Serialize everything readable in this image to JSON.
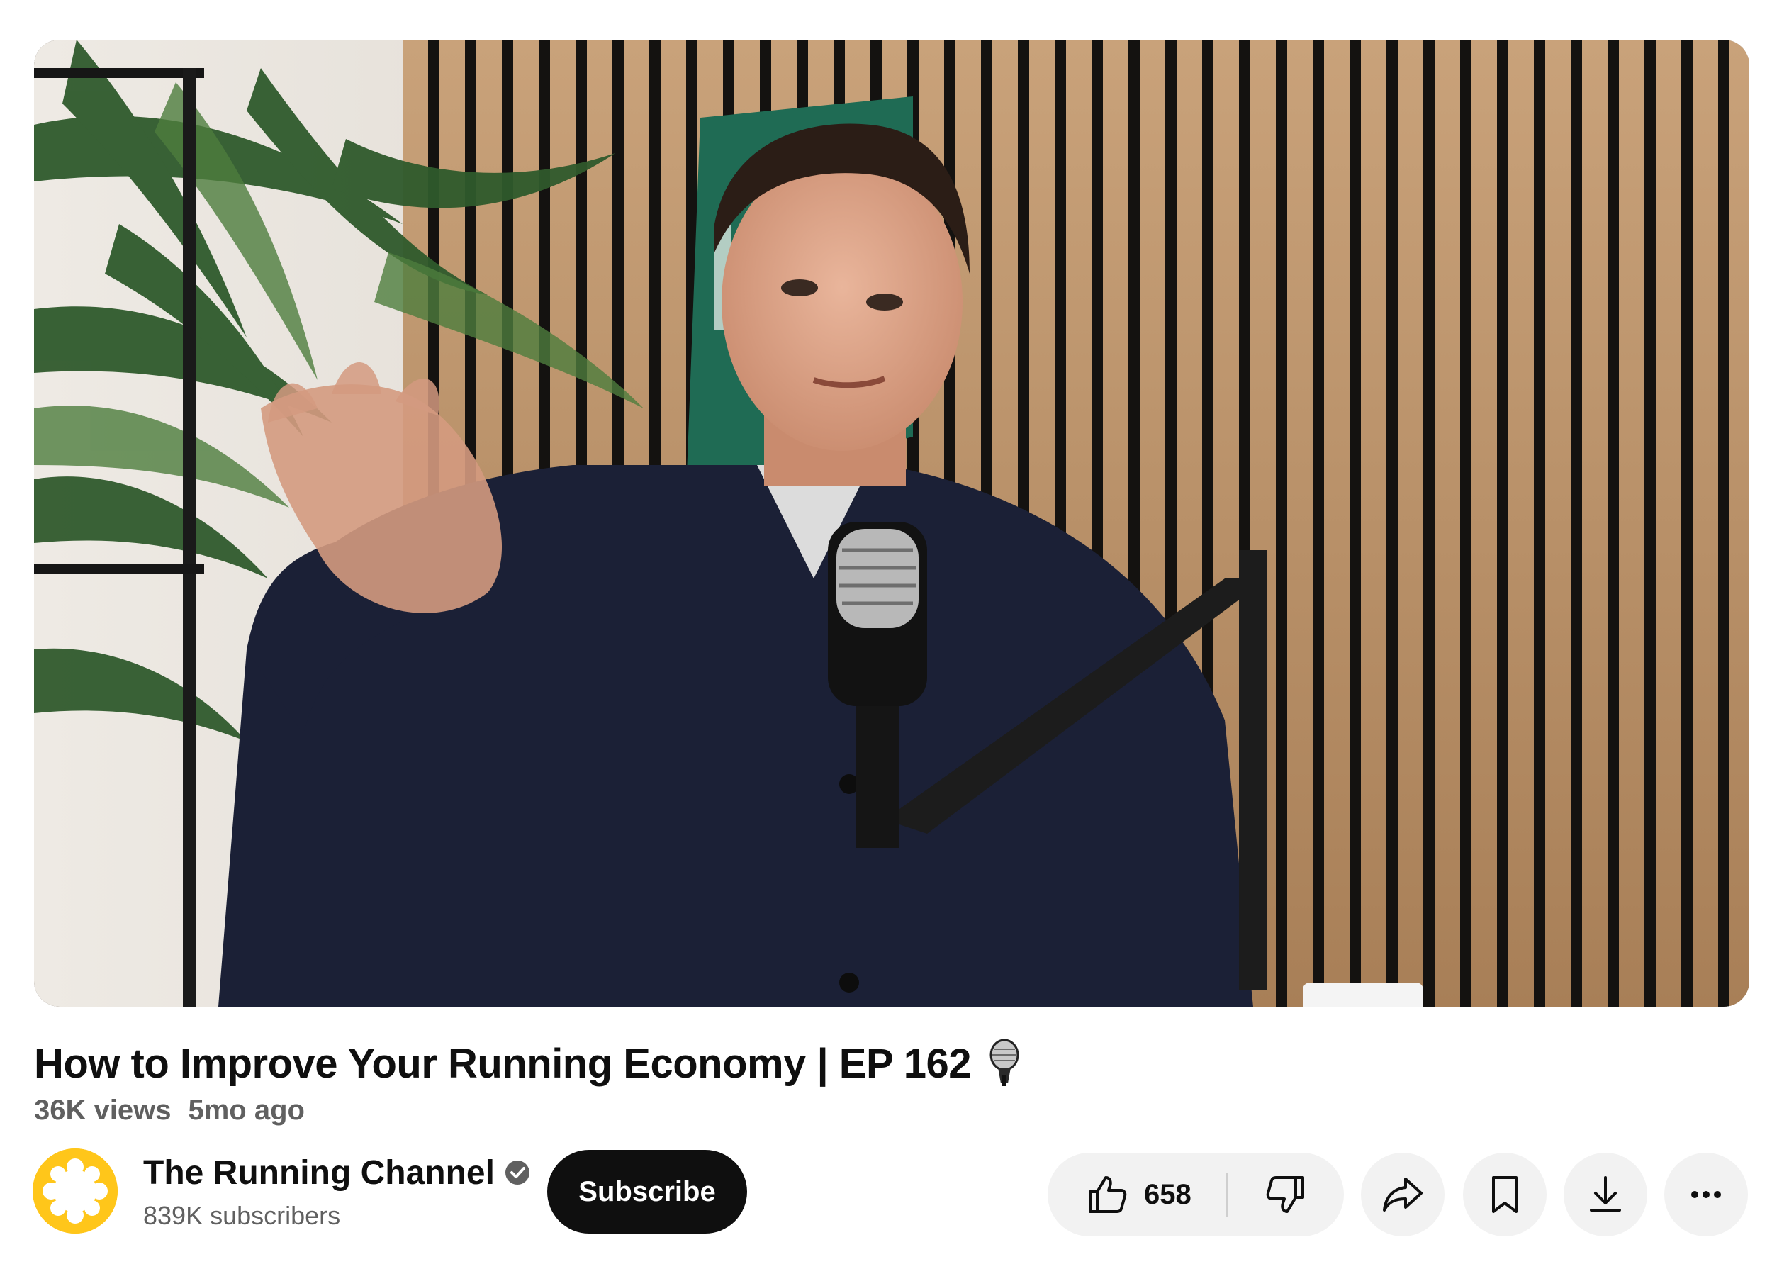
{
  "video": {
    "title": "How to Improve Your Running Economy | EP 162",
    "title_emoji_icon": "microphone-icon",
    "views": "36K views",
    "age": "5mo ago"
  },
  "channel": {
    "name": "The Running Channel",
    "verified_icon": "verified-check-icon",
    "subscribers": "839K subscribers",
    "avatar_color": "#ffc61a"
  },
  "subscribe": {
    "label": "Subscribe"
  },
  "actions": {
    "like_icon": "thumbs-up-icon",
    "like_count": "658",
    "dislike_icon": "thumbs-down-icon",
    "share_icon": "share-arrow-icon",
    "save_icon": "bookmark-icon",
    "download_icon": "download-icon",
    "more_icon": "more-horizontal-icon"
  },
  "colors": {
    "text_primary": "#0f0f0f",
    "text_secondary": "#606060",
    "button_bg": "#f2f2f2",
    "subscribe_bg": "#0f0f0f"
  }
}
